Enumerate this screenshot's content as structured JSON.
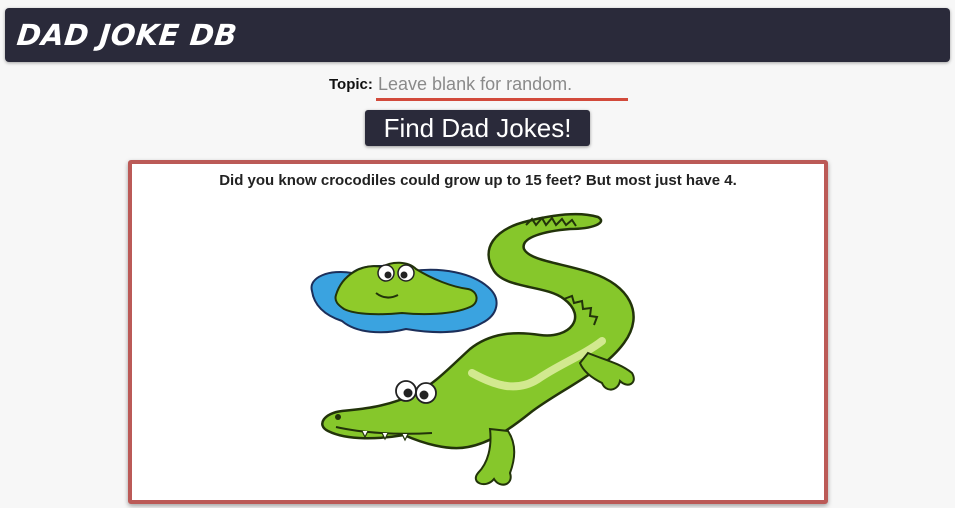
{
  "header": {
    "title": "DAD JOKE DB"
  },
  "search": {
    "topic_label": "Topic:",
    "topic_placeholder": "Leave blank for random.",
    "topic_value": "",
    "button_label": "Find Dad Jokes!"
  },
  "results": [
    {
      "joke": "Did you know crocodiles could grow up to 15 feet? But most just have 4.",
      "image": "cartoon-crocodiles-illustration"
    }
  ],
  "colors": {
    "header_bg": "#2a2a3a",
    "accent_underline": "#d24a3b",
    "card_border": "#bb5a57",
    "page_bg": "#f7f7f7"
  }
}
